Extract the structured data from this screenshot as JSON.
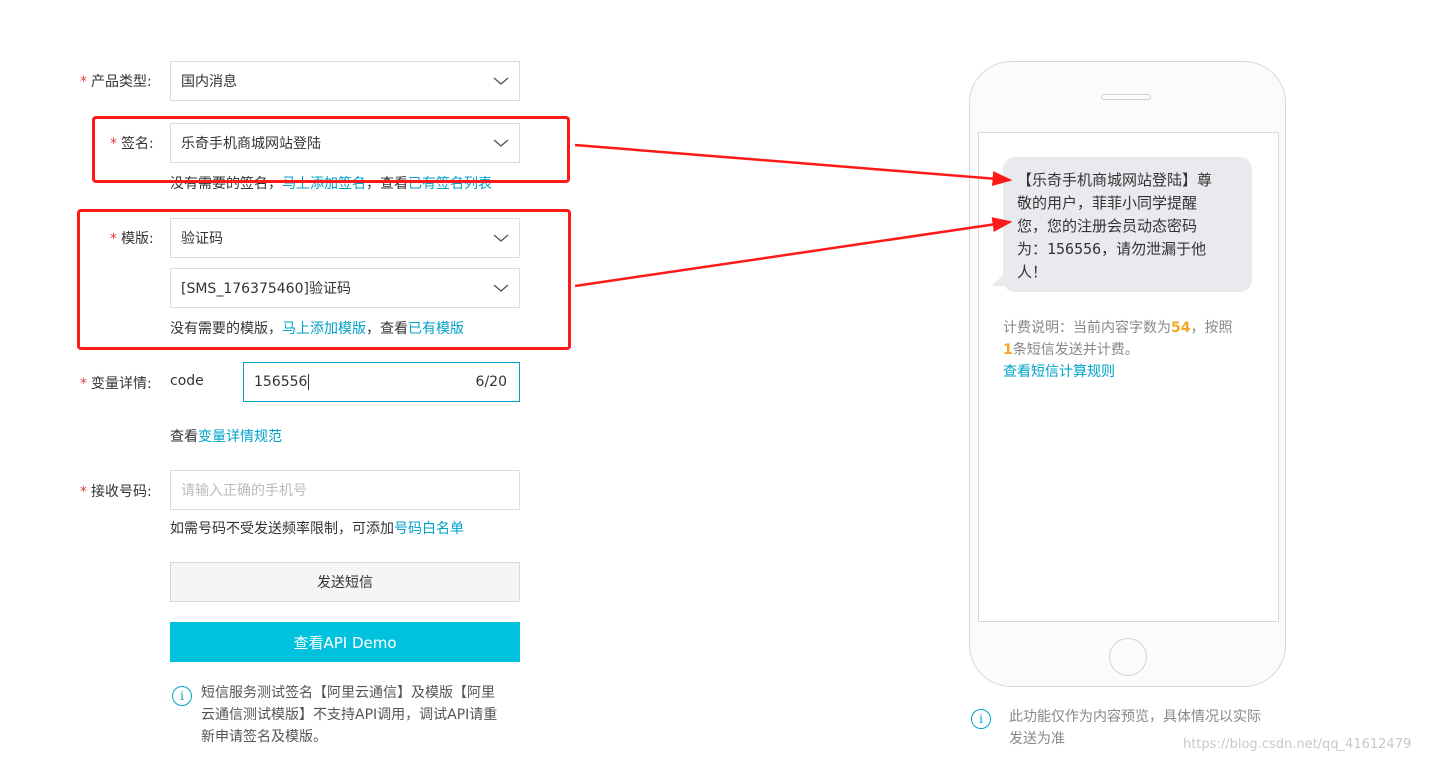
{
  "form": {
    "product_type": {
      "label": "产品类型:",
      "value": "国内消息"
    },
    "signature": {
      "label": "签名:",
      "value": "乐奇手机商城网站登陆",
      "hint_prefix": "没有需要的签名，",
      "hint_link1": "马上添加签名",
      "hint_mid": "，查看",
      "hint_link2": "已有签名列表"
    },
    "template": {
      "label": "模版:",
      "value": "验证码",
      "value2": "[SMS_176375460]验证码",
      "hint_prefix": "没有需要的模版，",
      "hint_link1": "马上添加模版",
      "hint_mid": "，查看",
      "hint_link2": "已有模版"
    },
    "variables": {
      "label": "变量详情:",
      "name": "code",
      "value": "156556",
      "counter": "6/20",
      "hint_prefix": "查看",
      "hint_link": "变量详情规范"
    },
    "phone": {
      "label": "接收号码:",
      "placeholder": "请输入正确的手机号",
      "hint_prefix": "如需号码不受发送频率限制，可添加",
      "hint_link": "号码白名单"
    },
    "required_mark": "*",
    "send_button": "发送短信",
    "api_demo_button": "查看API Demo",
    "notice": {
      "line1": "短信服务测试签名【阿里云通信】及模版【阿里",
      "line2": "云通信测试模版】不支持API调用，调试API请重",
      "line3": "新申请签名及模版。"
    }
  },
  "preview": {
    "message": {
      "line1": "【乐奇手机商城网站登陆】尊",
      "line2": "敬的用户，菲菲小同学提醒",
      "line3": "您，您的注册会员动态密码",
      "line4": "为：156556，请勿泄漏于他",
      "line5": "人！"
    },
    "fee": {
      "prefix": "计费说明：当前内容字数为",
      "count": "54",
      "mid": "，按照",
      "parts": "1",
      "suffix": "条短信发送并计费。",
      "rule_link": "查看短信计算规则"
    },
    "disclaimer": {
      "line1": "此功能仅作为内容预览，具体情况以实际",
      "line2": "发送为准"
    }
  },
  "watermark": "https://blog.csdn.net/qq_41612479",
  "info_glyph": "i",
  "colors": {
    "accent": "#00a2ca",
    "primary_button": "#00c1de",
    "required": "#e4393c",
    "annotation": "#ff1a1a",
    "highlight": "#f5a623"
  }
}
